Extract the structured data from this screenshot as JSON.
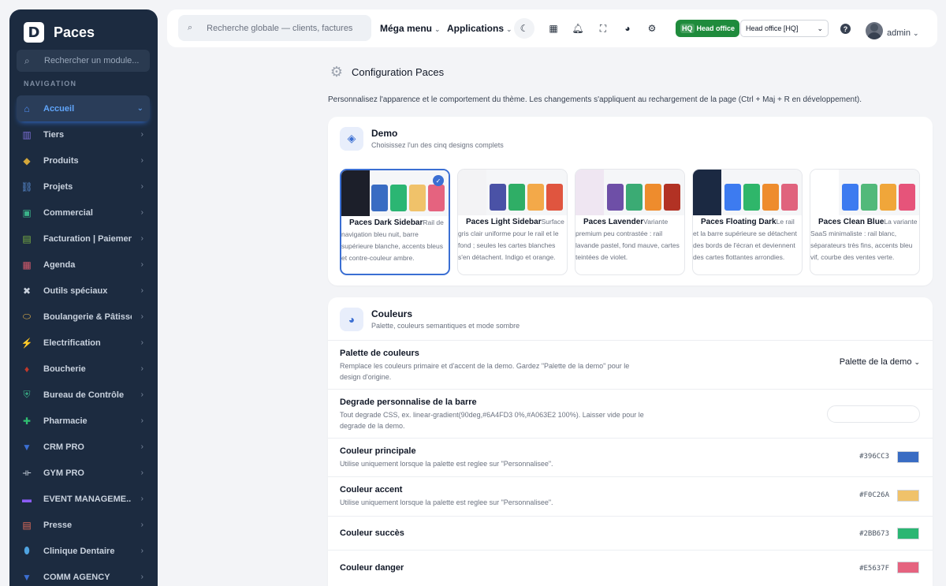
{
  "brand": {
    "logo_letter": "D",
    "name": "Paces"
  },
  "sidebar": {
    "search_placeholder": "Rechercher un module...",
    "nav_title": "NAVIGATION",
    "items": [
      {
        "label": "Accueil",
        "icon": "home-icon",
        "glyph": "⌂",
        "color": "#4f8ef7",
        "active": true,
        "chevron": "⌄"
      },
      {
        "label": "Tiers",
        "icon": "building-icon",
        "glyph": "▥",
        "color": "#7c6fd6",
        "chevron": "›"
      },
      {
        "label": "Produits",
        "icon": "box-icon",
        "glyph": "◆",
        "color": "#d4a73a",
        "chevron": "›"
      },
      {
        "label": "Projets",
        "icon": "project-icon",
        "glyph": "⛓",
        "color": "#5b8fd6",
        "chevron": "›"
      },
      {
        "label": "Commercial",
        "icon": "briefcase-icon",
        "glyph": "▣",
        "color": "#3bb38a",
        "chevron": "›"
      },
      {
        "label": "Facturation | Paiement",
        "icon": "invoice-icon",
        "glyph": "▤",
        "color": "#7bb342",
        "chevron": "›"
      },
      {
        "label": "Agenda",
        "icon": "calendar-icon",
        "glyph": "▦",
        "color": "#d65b6c",
        "chevron": "›"
      },
      {
        "label": "Outils spéciaux",
        "icon": "tools-icon",
        "glyph": "✖",
        "color": "#c9d2de",
        "chevron": "›"
      },
      {
        "label": "Boulangerie & Pâtisse...",
        "icon": "bread-icon",
        "glyph": "⬭",
        "color": "#e7b44a",
        "chevron": "›"
      },
      {
        "label": "Electrification",
        "icon": "bolt-icon",
        "glyph": "⚡",
        "color": "#f5c518",
        "chevron": "›"
      },
      {
        "label": "Boucherie",
        "icon": "meat-icon",
        "glyph": "♦",
        "color": "#c0392b",
        "chevron": "›"
      },
      {
        "label": "Bureau de Contrôle",
        "icon": "shield-icon",
        "glyph": "⛨",
        "color": "#3bb38a",
        "chevron": "›"
      },
      {
        "label": "Pharmacie",
        "icon": "cross-icon",
        "glyph": "✚",
        "color": "#2fbf71",
        "chevron": "›"
      },
      {
        "label": "CRM PRO",
        "icon": "funnel-icon",
        "glyph": "▼",
        "color": "#3b6fd3",
        "chevron": "›"
      },
      {
        "label": "GYM PRO",
        "icon": "dumbbell-icon",
        "glyph": "⟛",
        "color": "#c9d2de",
        "chevron": "›"
      },
      {
        "label": "EVENT MANAGEME...",
        "icon": "ticket-icon",
        "glyph": "▬",
        "color": "#8b5cf6",
        "chevron": "›"
      },
      {
        "label": "Presse",
        "icon": "newspaper-icon",
        "glyph": "▤",
        "color": "#e26d5a",
        "chevron": "›"
      },
      {
        "label": "Clinique Dentaire",
        "icon": "tooth-icon",
        "glyph": "⬮",
        "color": "#4fa3e0",
        "chevron": "›"
      },
      {
        "label": "COMM AGENCY",
        "icon": "funnel-icon",
        "glyph": "▼",
        "color": "#3b6fd3",
        "chevron": "›"
      }
    ]
  },
  "topbar": {
    "search_placeholder": "Recherche globale — clients, factures, p",
    "mega_menu": "Méga menu",
    "applications": "Applications",
    "caret": "⌄",
    "hq_tag": "HQ",
    "hq_label": "Head office",
    "office_select": "Head office [HQ]",
    "help": "?",
    "user": "admin"
  },
  "page": {
    "title": "Configuration Paces",
    "description": "Personnalisez l'apparence et le comportement du thème. Les changements s'appliquent au rechargement de la page (Ctrl + Maj + R en développement)."
  },
  "demo_card": {
    "title": "Demo",
    "subtitle": "Choisissez l'un des cinq designs complets",
    "demos": [
      {
        "name": "Paces Dark Sidebar",
        "desc": "Rail de navigation bleu nuit, barre supérieure blanche, accents bleus et contre-couleur ambre.",
        "rail": "#1c1f2a",
        "swatches": [
          "#396CC3",
          "#2BB673",
          "#F0C26A",
          "#E5637F"
        ],
        "selected": true
      },
      {
        "name": "Paces Light Sidebar",
        "desc": "Surface gris clair uniforme pour le rail et le fond ; seules les cartes blanches s'en détachent. Indigo et orange.",
        "rail": "#f3f3f5",
        "swatches": [
          "#4a52a6",
          "#2fae66",
          "#f3a949",
          "#e0553f"
        ],
        "selected": false
      },
      {
        "name": "Paces Lavender",
        "desc": "Variante premium peu contrastée : rail lavande pastel, fond mauve, cartes teintées de violet.",
        "rail": "#efe6f2",
        "swatches": [
          "#6e4fa7",
          "#3bab74",
          "#ee8c2d",
          "#b23224"
        ],
        "selected": false
      },
      {
        "name": "Paces Floating Dark",
        "desc": "Le rail et la barre supérieure se détachent des bords de l'écran et deviennent des cartes flottantes arrondies.",
        "rail": "#1b2942",
        "swatches": [
          "#3d7bf0",
          "#2fb66a",
          "#ee8c2d",
          "#e0637d"
        ],
        "selected": false
      },
      {
        "name": "Paces Clean Blue",
        "desc": "La variante SaaS minimaliste : rail blanc, séparateurs très fins, accents bleu vif, courbe des ventes verte.",
        "rail": "#ffffff",
        "swatches": [
          "#3d7bf0",
          "#52b97a",
          "#f0a63a",
          "#e6547a"
        ],
        "selected": false
      }
    ]
  },
  "colors_card": {
    "title": "Couleurs",
    "subtitle": "Palette, couleurs semantiques et mode sombre",
    "palette": {
      "label": "Palette de couleurs",
      "help": "Remplace les couleurs primaire et d'accent de la demo. Gardez \"Palette de la demo\" pour le design d'origine.",
      "value": "Palette de la demo"
    },
    "gradient": {
      "label": "Degrade personnalise de la barre",
      "help": "Tout degrade CSS, ex. linear-gradient(90deg,#6A4FD3 0%,#A063E2 100%). Laisser vide pour le degrade de la demo.",
      "value": ""
    },
    "primary": {
      "label": "Couleur principale",
      "help": "Utilise uniquement lorsque la palette est reglee sur \"Personnalisee\".",
      "hex": "#396CC3"
    },
    "accent": {
      "label": "Couleur accent",
      "help": "Utilise uniquement lorsque la palette est reglee sur \"Personnalisee\".",
      "hex": "#F0C26A"
    },
    "success": {
      "label": "Couleur succès",
      "hex": "#2BB673"
    },
    "danger": {
      "label": "Couleur danger",
      "hex": "#E5637F"
    }
  }
}
